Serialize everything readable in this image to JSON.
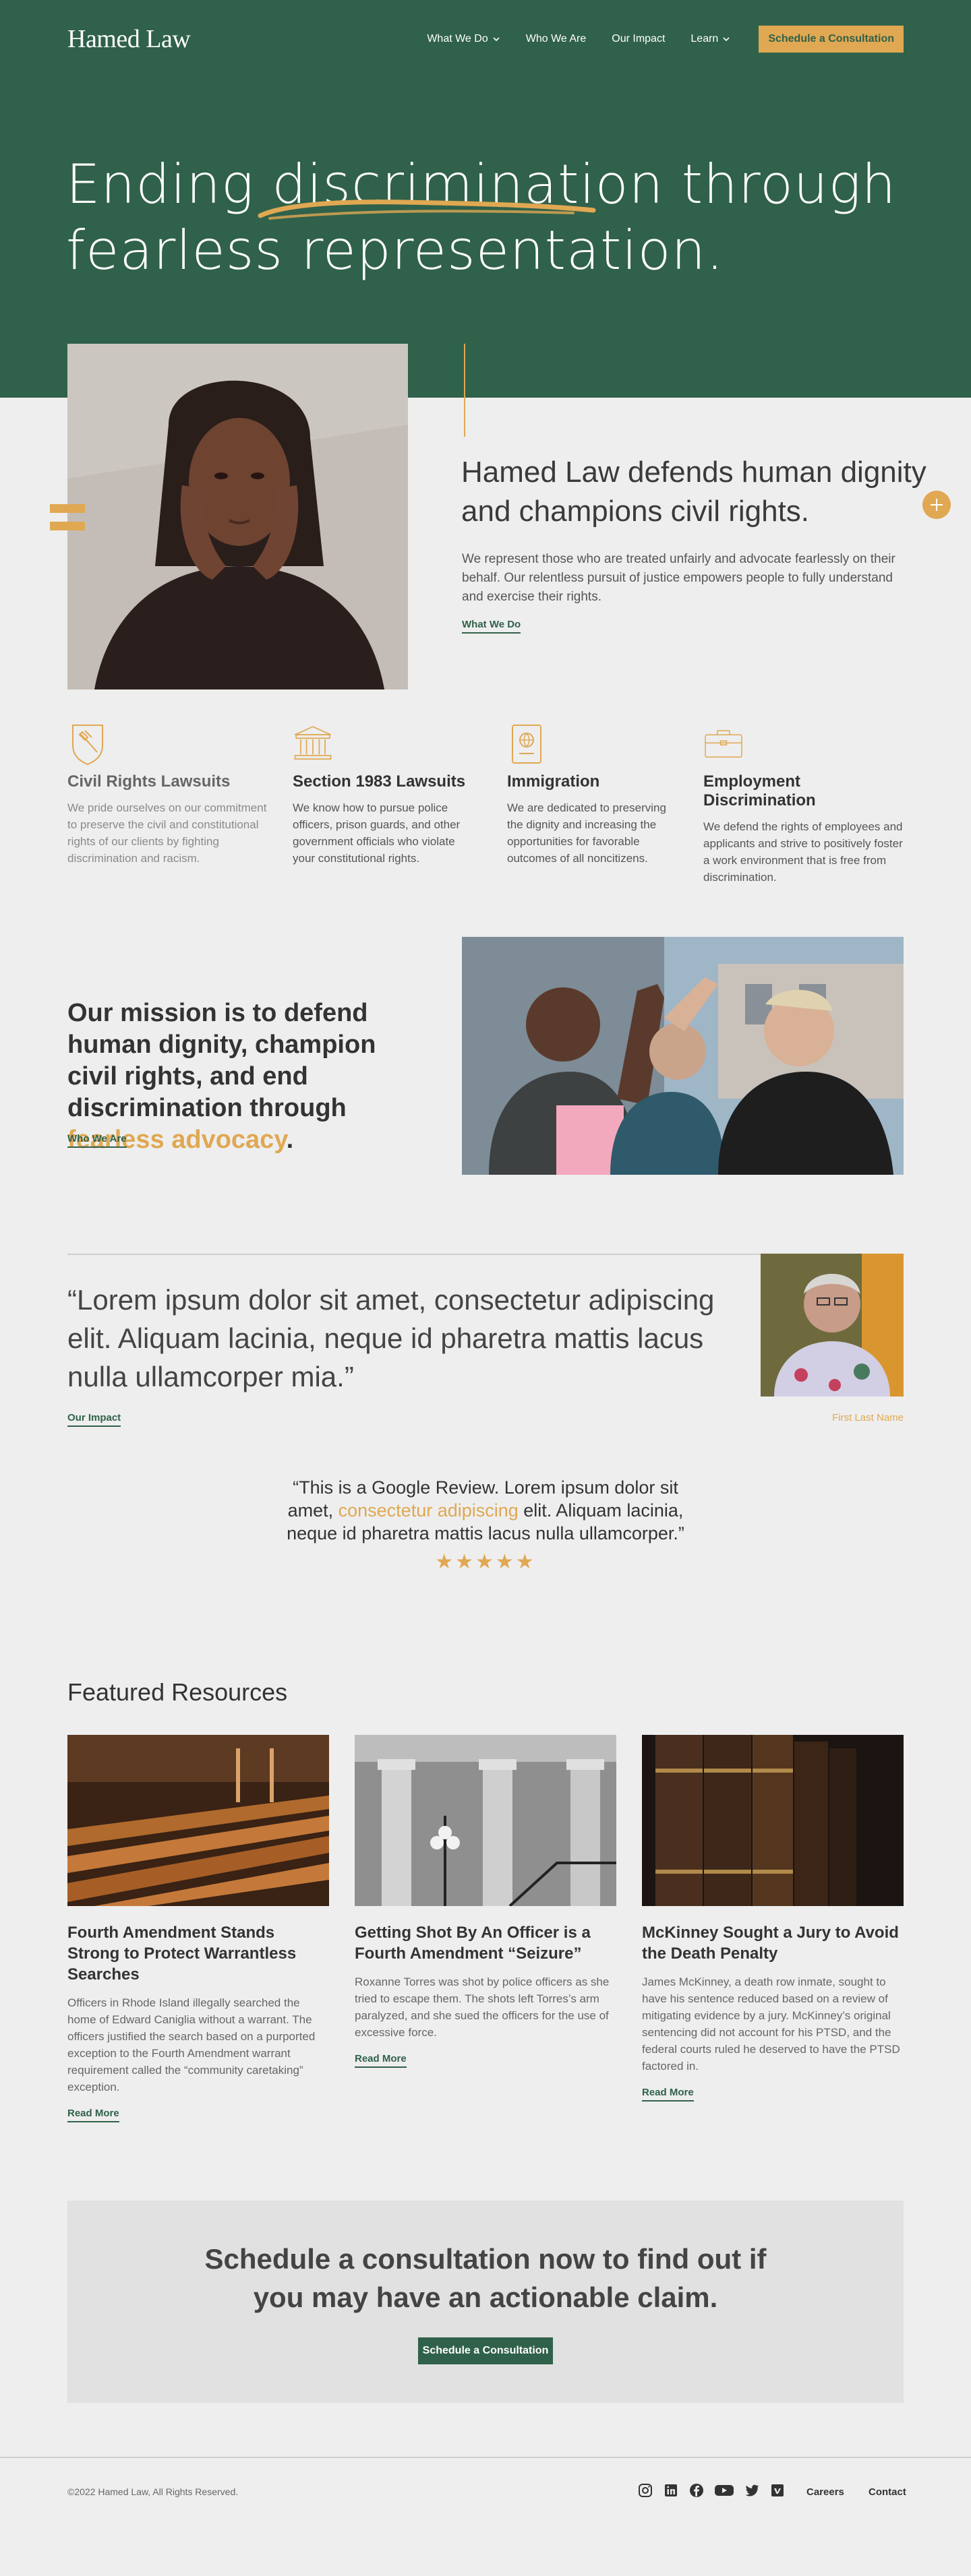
{
  "brand": {
    "logo": "Hamed Law",
    "green": "#30614a",
    "gold": "#e0a852"
  },
  "nav": {
    "items": [
      {
        "label": "What We Do",
        "dropdown": true
      },
      {
        "label": "Who We Are",
        "dropdown": false
      },
      {
        "label": "Our Impact",
        "dropdown": false
      },
      {
        "label": "Learn",
        "dropdown": true
      }
    ],
    "cta": "Schedule a Consultation"
  },
  "hero": {
    "title": "Ending discrimination through fearless representation."
  },
  "intro": {
    "heading": "Hamed Law defends human dignity and champions civil rights.",
    "text": "We represent those who are treated unfairly and advocate fearlessly on their behalf. Our relentless pursuit of justice empowers people to fully understand and exercise their rights.",
    "link": "What We Do"
  },
  "areas": [
    {
      "icon": "gavel-shield-icon",
      "title": "Civil Rights Lawsuits",
      "text": "We pride ourselves on our commitment to preserve the civil and constitutional rights of our clients by fighting discrimination and racism."
    },
    {
      "icon": "courthouse-icon",
      "title": "Section 1983 Lawsuits",
      "text": "We know how to pursue police officers, prison guards, and other government officials who violate your constitutional rights."
    },
    {
      "icon": "passport-icon",
      "title": "Immigration",
      "text": "We are dedicated to preserving the dignity and increasing the opportunities for favorable outcomes of all noncitizens."
    },
    {
      "icon": "briefcase-icon",
      "title": "Employment Discrimination",
      "text": "We defend the rights of employees and applicants and strive to positively foster a work environment that is free from discrimination."
    }
  ],
  "mission": {
    "text_before": "Our mission is to defend human dignity, champion civil rights, and end discrimination through ",
    "accent": "fearless advocacy",
    "text_after": ".",
    "link": "Who We Are"
  },
  "quote": {
    "text": "“Lorem ipsum dolor sit amet, consectetur adipiscing elit. Aliquam lacinia, neque id pharetra mattis lacus nulla ullamcorper mia.”",
    "link": "Our Impact",
    "name": "First Last Name"
  },
  "review": {
    "before": "“This is a Google Review. Lorem ipsum dolor sit amet, ",
    "accent": "consectetur adipiscing",
    "after": " elit. Aliquam lacinia, neque id pharetra mattis lacus nulla ullamcorper.”",
    "rating": 5,
    "stars": "★★★★★"
  },
  "resources": {
    "heading": "Featured Resources",
    "cards": [
      {
        "title": "Fourth Amendment Stands Strong to Protect Warrantless Searches",
        "text": "Officers in Rhode Island illegally searched the home of Edward Caniglia without a warrant. The officers justified the search based on a purported exception to the Fourth Amendment warrant requirement called the “community caretaking” exception.",
        "link": "Read More"
      },
      {
        "title": "Getting Shot By An Officer is a Fourth Amendment “Seizure”",
        "text": "Roxanne Torres was shot by police officers as she tried to escape them. The shots left Torres’s arm paralyzed, and she sued the officers for the use of excessive force.",
        "link": "Read More"
      },
      {
        "title": "McKinney Sought a Jury to Avoid the Death Penalty",
        "text": "James McKinney, a death row inmate, sought to have his sentence reduced based on a review of mitigating evidence by a jury. McKinney’s original sentencing did not account for his PTSD, and the federal courts ruled he deserved to have the PTSD factored in.",
        "link": "Read More"
      }
    ]
  },
  "cta": {
    "text": "Schedule a consultation now to find out if you may have an actionable claim.",
    "button": "Schedule a Consultation"
  },
  "footer": {
    "copyright": "©2022 Hamed Law, All Rights Reserved.",
    "socials": [
      "instagram-icon",
      "linkedin-icon",
      "facebook-icon",
      "youtube-icon",
      "twitter-icon",
      "vimeo-icon"
    ],
    "links": [
      "Careers",
      "Contact"
    ]
  }
}
